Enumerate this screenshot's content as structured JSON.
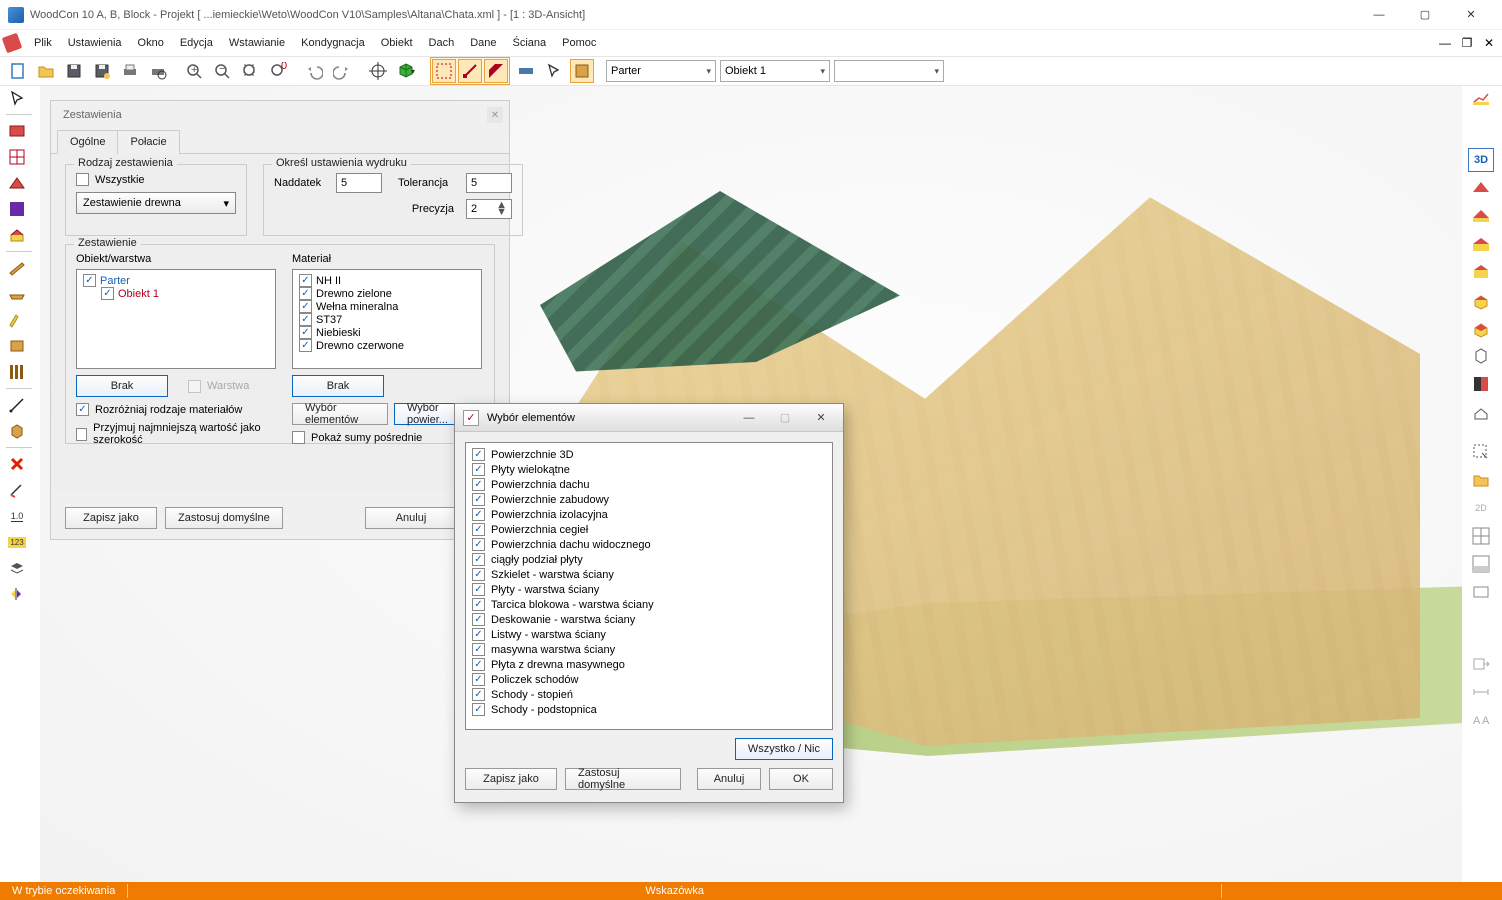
{
  "window": {
    "title": "WoodCon 10 A, B, Block - Projekt [ ...iemieckie\\Weto\\WoodCon V10\\Samples\\Altana\\Chata.xml ]  - [1 : 3D-Ansicht]"
  },
  "menu": {
    "items": [
      "Plik",
      "Ustawienia",
      "Okno",
      "Edycja",
      "Wstawianie",
      "Kondygnacja",
      "Obiekt",
      "Dach",
      "Dane",
      "Ściana",
      "Pomoc"
    ]
  },
  "toolbar": {
    "combo_floor": "Parter",
    "combo_object": "Obiekt 1",
    "combo_empty": ""
  },
  "zest_panel": {
    "title": "Zestawienia",
    "tabs": {
      "ogolne": "Ogólne",
      "polacie": "Połacie"
    },
    "rodzaj_legend": "Rodzaj zestawienia",
    "wszystkie_label": "Wszystkie",
    "combo_value": "Zestawienie drewna",
    "okresl_legend": "Określ ustawienia wydruku",
    "naddatek_label": "Naddatek",
    "naddatek_value": "5",
    "tolerancja_label": "Tolerancja",
    "tolerancja_value": "5",
    "precyzja_label": "Precyzja",
    "precyzja_value": "2",
    "zestawienie_legend": "Zestawienie",
    "obiekt_label": "Obiekt/warstwa",
    "tree_parent": "Parter",
    "tree_child": "Obiekt 1",
    "brak1": "Brak",
    "warstwa_label": "Warstwa",
    "material_legend": "Materiał",
    "materials": [
      "NH II",
      "Drewno zielone",
      "Wełna mineralna",
      "ST37",
      "Niebieski",
      "Drewno czerwone"
    ],
    "brak2": "Brak",
    "wybor_elementow_btn": "Wybór elementów",
    "wybor_powierzchni_btn": "Wybór powier...",
    "chk_rozroz": "Rozróżniaj rodzaje materiałów",
    "chk_przyjmuj": "Przyjmuj najmniejszą wartość jako szerokość",
    "chk_pokaz": "Pokaż sumy pośrednie",
    "btn_zapisz": "Zapisz jako",
    "btn_domyslne": "Zastosuj domyślne",
    "btn_anuluj": "Anuluj"
  },
  "wybor_dialog": {
    "title": "Wybór elementów",
    "items": [
      "Powierzchnie 3D",
      "Płyty wielokątne",
      "Powierzchnia dachu",
      "Powierzchnie zabudowy",
      "Powierzchnia izolacyjna",
      "Powierzchnia cegieł",
      "Powierzchnia dachu widocznego",
      "ciągły podział płyty",
      "Szkielet - warstwa ściany",
      "Płyty - warstwa ściany",
      "Tarcica blokowa - warstwa ściany",
      "Deskowanie - warstwa ściany",
      "Listwy - warstwa ściany",
      "masywna warstwa ściany",
      "Płyta z drewna masywnego",
      "Policzek schodów",
      "Schody - stopień",
      "Schody - podstopnica"
    ],
    "btn_all": "Wszystko / Nic",
    "btn_zapisz": "Zapisz jako",
    "btn_domyslne": "Zastosuj domyślne",
    "btn_anuluj": "Anuluj",
    "btn_ok": "OK"
  },
  "status": {
    "left": "W trybie oczekiwania",
    "mid": "Wskazówka"
  },
  "right_rail": {
    "label_3d": "3D"
  }
}
